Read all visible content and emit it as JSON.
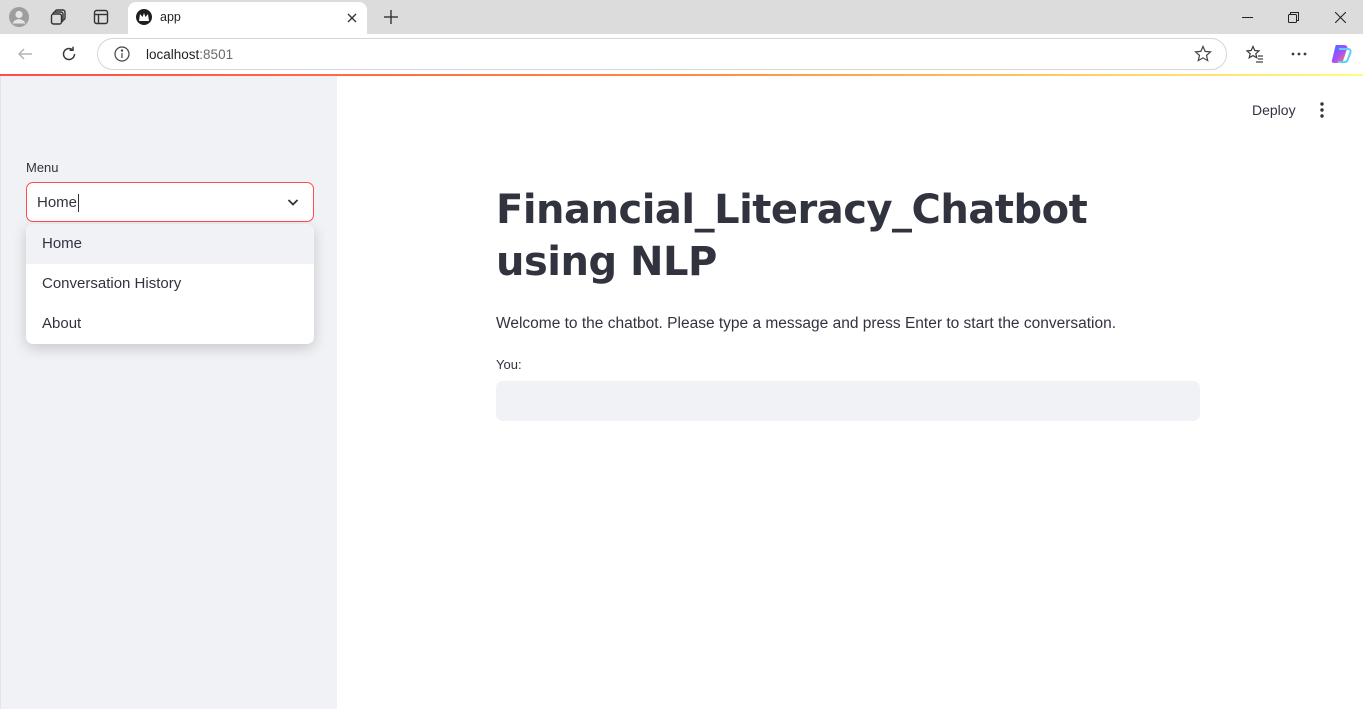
{
  "browser": {
    "tab_title": "app",
    "url_host": "localhost",
    "url_port": ":8501"
  },
  "sidebar": {
    "menu_label": "Menu",
    "selected_value": "Home",
    "options": [
      "Home",
      "Conversation History",
      "About"
    ],
    "active_option": "Home"
  },
  "header": {
    "deploy_label": "Deploy"
  },
  "main": {
    "title": "Financial_Literacy_Chatbot using NLP",
    "welcome_text": "Welcome to the chatbot. Please type a message and press Enter to start the conversation.",
    "input_label": "You:",
    "input_value": ""
  },
  "colors": {
    "accent": "#ff4b4b",
    "sidebar_bg": "#f0f2f6",
    "text": "#31333f"
  },
  "icons": [
    "profile-icon",
    "workspaces-icon",
    "tab-actions-icon",
    "app-favicon",
    "close-icon",
    "plus-icon",
    "minimize-icon",
    "restore-icon",
    "window-close-icon",
    "back-icon",
    "reload-icon",
    "info-icon",
    "star-icon",
    "favorites-icon",
    "more-icon",
    "copilot-icon",
    "chevron-down-icon",
    "kebab-menu-icon"
  ]
}
